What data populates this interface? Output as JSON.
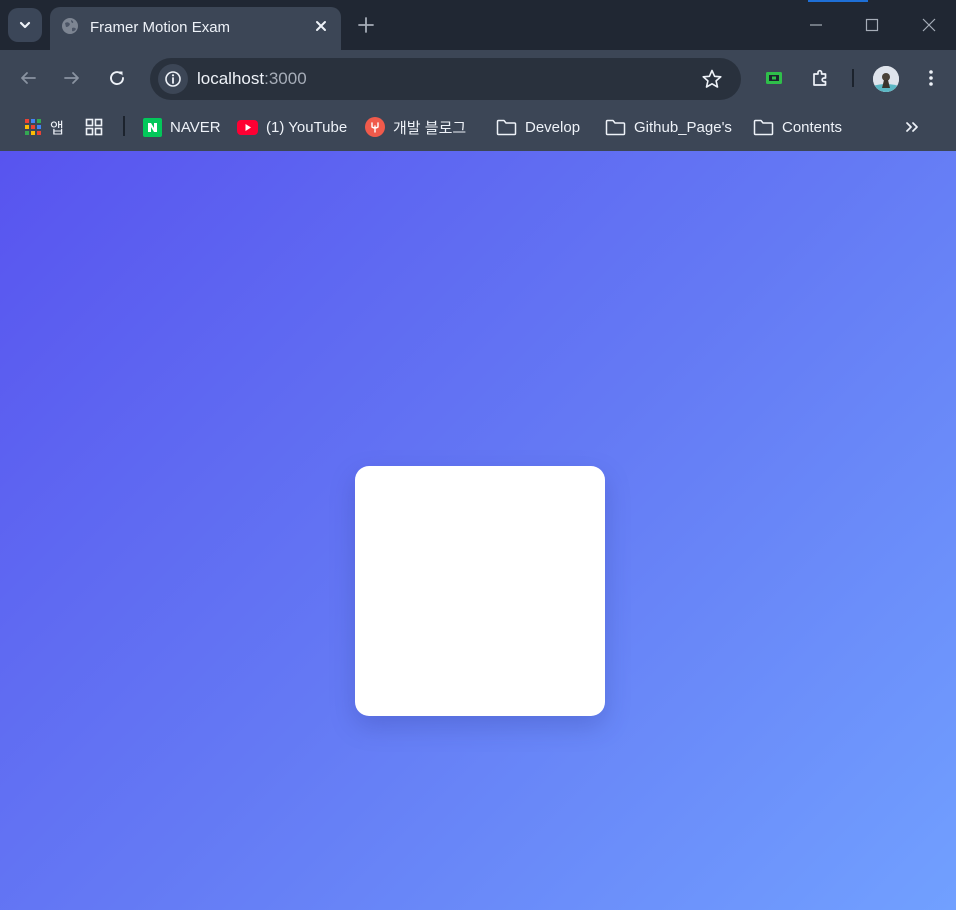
{
  "browser": {
    "tab": {
      "title": "Framer Motion Exam"
    },
    "address": {
      "host": "localhost",
      "port": ":3000"
    }
  },
  "bookmarks": {
    "apps": "앱",
    "items": [
      {
        "label": "NAVER",
        "icon": "naver-icon"
      },
      {
        "label": "(1) YouTube",
        "icon": "youtube-icon"
      },
      {
        "label": "개발 블로그",
        "icon": "blog-icon"
      },
      {
        "label": "Develop",
        "icon": "folder-icon"
      },
      {
        "label": "Github_Page's",
        "icon": "folder-icon"
      },
      {
        "label": "Contents",
        "icon": "folder-icon"
      }
    ]
  },
  "colors": {
    "gradient_start": "#5854ef",
    "gradient_end": "#71a0ff",
    "card": "#ffffff",
    "chrome_dark": "#202733",
    "chrome_toolbar": "#3c4656"
  }
}
